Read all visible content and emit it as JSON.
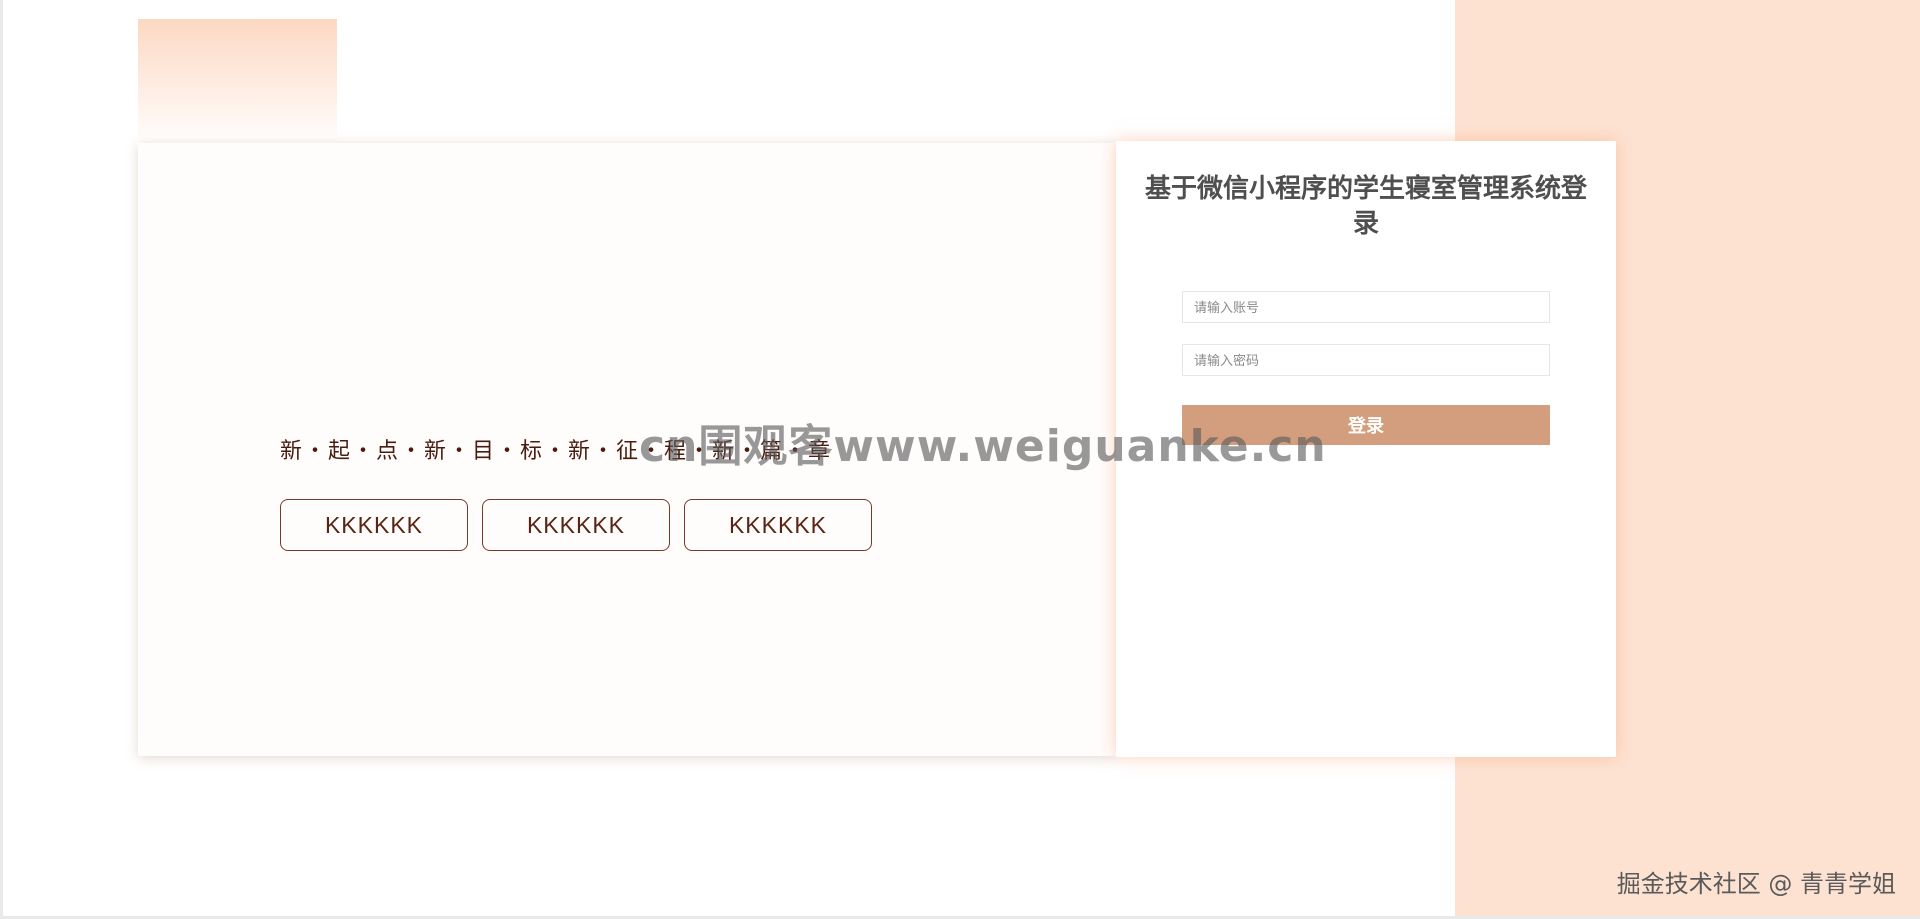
{
  "login": {
    "title": "基于微信小程序的学生寝室管理系统登录",
    "account_placeholder": "请输入账号",
    "password_placeholder": "请输入密码",
    "submit_label": "登录"
  },
  "hero": {
    "slogan": "新・起・点・新・目・标・新・征・程・新・篇・章",
    "buttons": [
      {
        "label": "KKKKKK"
      },
      {
        "label": "KKKKKK"
      },
      {
        "label": "KKKKKK"
      }
    ]
  },
  "watermarks": {
    "center": "cn围观客www.weiguanke.cn",
    "corner": "掘金技术社区 @ 青青学姐"
  },
  "colors": {
    "accent_panel": "#fde2d2",
    "login_button": "#d39e7e",
    "slogan_text": "#4a1c10",
    "button_border": "#7a3a2a"
  }
}
